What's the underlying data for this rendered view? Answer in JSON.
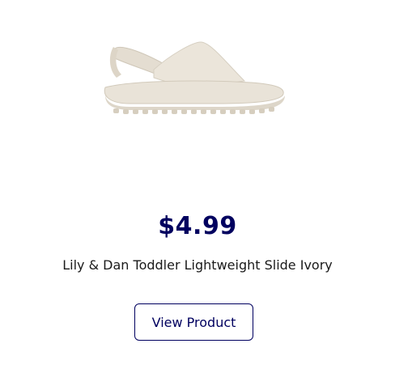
{
  "product": {
    "image_icon": "sandal-product-image",
    "price": "$4.99",
    "title": "Lily & Dan Toddler Lightweight Slide Ivory",
    "button_label": "View Product"
  },
  "colors": {
    "brand": "#00005f",
    "text": "#1a1a1a",
    "sandal": "#e7e1d6"
  }
}
